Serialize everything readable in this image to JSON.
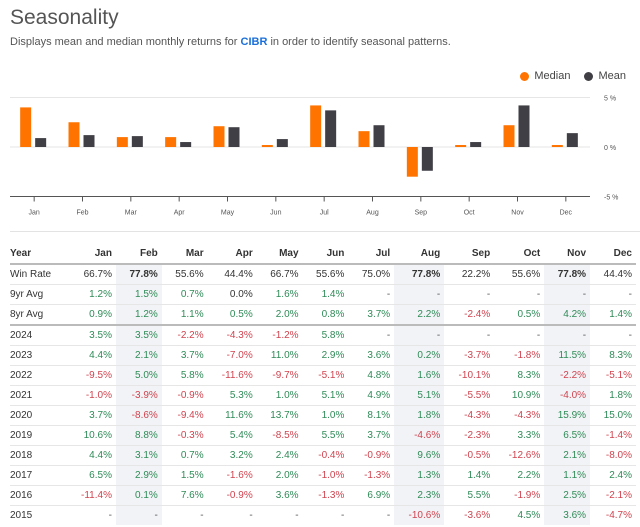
{
  "header": {
    "title": "Seasonality",
    "subtitle_prefix": "Displays mean and median monthly returns for ",
    "ticker": "CIBR",
    "subtitle_suffix": " in order to identify seasonal patterns."
  },
  "colors": {
    "median": "#ff7400",
    "mean": "#3f3f45",
    "positive": "#2e8b57",
    "negative": "#d0434f",
    "ticker": "#1a6fd8"
  },
  "chart_data": {
    "type": "bar",
    "title": "",
    "categories": [
      "Jan",
      "Feb",
      "Mar",
      "Apr",
      "May",
      "Jun",
      "Jul",
      "Aug",
      "Sep",
      "Oct",
      "Nov",
      "Dec"
    ],
    "series": [
      {
        "name": "Median",
        "values": [
          4.0,
          2.5,
          1.0,
          1.0,
          2.1,
          0.2,
          4.2,
          1.6,
          -3.0,
          0.2,
          2.2,
          0.2
        ]
      },
      {
        "name": "Mean",
        "values": [
          0.9,
          1.2,
          1.1,
          0.5,
          2.0,
          0.8,
          3.7,
          2.2,
          -2.4,
          0.5,
          4.2,
          1.4
        ]
      }
    ],
    "ylim": [
      -5,
      5
    ],
    "yticks": [
      "5 %",
      "0 %",
      "-5 %"
    ],
    "ytick_values": [
      5,
      0,
      -5
    ],
    "xlabel": "",
    "ylabel": "",
    "grid": true,
    "legend": "top-right"
  },
  "legend": {
    "median": "Median",
    "mean": "Mean"
  },
  "table": {
    "headers": [
      "Year",
      "Jan",
      "Feb",
      "Mar",
      "Apr",
      "May",
      "Jun",
      "Jul",
      "Aug",
      "Sep",
      "Oct",
      "Nov",
      "Dec"
    ],
    "highlight_columns": [
      "Feb",
      "Aug",
      "Nov"
    ],
    "rows": [
      {
        "label": "Win Rate",
        "type": "winrate",
        "cells": [
          "66.7%",
          "77.8%",
          "55.6%",
          "44.4%",
          "66.7%",
          "55.6%",
          "75.0%",
          "77.8%",
          "22.2%",
          "55.6%",
          "77.8%",
          "44.4%"
        ]
      },
      {
        "label": "9yr Avg",
        "type": "avg9",
        "cells": [
          "1.2%",
          "1.5%",
          "0.7%",
          "0.0%",
          "1.6%",
          "1.4%",
          "-",
          "-",
          "-",
          "-",
          "-",
          "-"
        ]
      },
      {
        "label": "8yr Avg",
        "type": "avg8",
        "cells": [
          "0.9%",
          "1.2%",
          "1.1%",
          "0.5%",
          "2.0%",
          "0.8%",
          "3.7%",
          "2.2%",
          "-2.4%",
          "0.5%",
          "4.2%",
          "1.4%"
        ]
      },
      {
        "label": "2024",
        "type": "year",
        "cells": [
          "3.5%",
          "3.5%",
          "-2.2%",
          "-4.3%",
          "-1.2%",
          "5.8%",
          "-",
          "-",
          "-",
          "-",
          "-",
          "-"
        ]
      },
      {
        "label": "2023",
        "type": "year",
        "cells": [
          "4.4%",
          "2.1%",
          "3.7%",
          "-7.0%",
          "11.0%",
          "2.9%",
          "3.6%",
          "0.2%",
          "-3.7%",
          "-1.8%",
          "11.5%",
          "8.3%"
        ]
      },
      {
        "label": "2022",
        "type": "year",
        "cells": [
          "-9.5%",
          "5.0%",
          "5.8%",
          "-11.6%",
          "-9.7%",
          "-5.1%",
          "4.8%",
          "1.6%",
          "-10.1%",
          "8.3%",
          "-2.2%",
          "-5.1%"
        ]
      },
      {
        "label": "2021",
        "type": "year",
        "cells": [
          "-1.0%",
          "-3.9%",
          "-0.9%",
          "5.3%",
          "1.0%",
          "5.1%",
          "4.9%",
          "5.1%",
          "-5.5%",
          "10.9%",
          "-4.0%",
          "1.8%"
        ]
      },
      {
        "label": "2020",
        "type": "year",
        "cells": [
          "3.7%",
          "-8.6%",
          "-9.4%",
          "11.6%",
          "13.7%",
          "1.0%",
          "8.1%",
          "1.8%",
          "-4.3%",
          "-4.3%",
          "15.9%",
          "15.0%"
        ]
      },
      {
        "label": "2019",
        "type": "year",
        "cells": [
          "10.6%",
          "8.8%",
          "-0.3%",
          "5.4%",
          "-8.5%",
          "5.5%",
          "3.7%",
          "-4.6%",
          "-2.3%",
          "3.3%",
          "6.5%",
          "-1.4%"
        ]
      },
      {
        "label": "2018",
        "type": "year",
        "cells": [
          "4.4%",
          "3.1%",
          "0.7%",
          "3.2%",
          "2.4%",
          "-0.4%",
          "-0.9%",
          "9.6%",
          "-0.5%",
          "-12.6%",
          "2.1%",
          "-8.0%"
        ]
      },
      {
        "label": "2017",
        "type": "year",
        "cells": [
          "6.5%",
          "2.9%",
          "1.5%",
          "-1.6%",
          "2.0%",
          "-1.0%",
          "-1.3%",
          "1.3%",
          "1.4%",
          "2.2%",
          "1.1%",
          "2.4%"
        ]
      },
      {
        "label": "2016",
        "type": "year",
        "cells": [
          "-11.4%",
          "0.1%",
          "7.6%",
          "-0.9%",
          "3.6%",
          "-1.3%",
          "6.9%",
          "2.3%",
          "5.5%",
          "-1.9%",
          "2.5%",
          "-2.1%"
        ]
      },
      {
        "label": "2015",
        "type": "year",
        "cells": [
          "-",
          "-",
          "-",
          "-",
          "-",
          "-",
          "-",
          "-10.6%",
          "-3.6%",
          "4.5%",
          "3.6%",
          "-4.7%"
        ]
      }
    ]
  }
}
